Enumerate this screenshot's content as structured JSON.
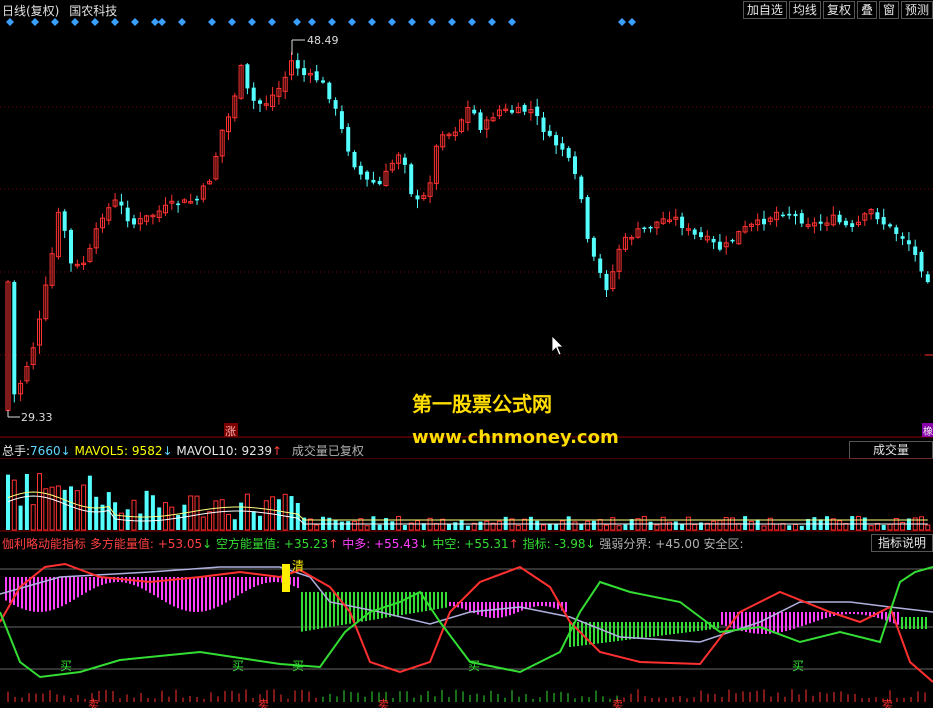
{
  "title": {
    "period": "日线(复权)",
    "stock_name": "国农科技"
  },
  "toolbar": [
    {
      "id": "add-watch",
      "label": "加自选"
    },
    {
      "id": "ma-lines",
      "label": "均线"
    },
    {
      "id": "adjust",
      "label": "复权"
    },
    {
      "id": "overlay",
      "label": "叠"
    },
    {
      "id": "window",
      "label": "窗"
    },
    {
      "id": "forecast",
      "label": "预测"
    }
  ],
  "price_chart": {
    "high_label": "48.49",
    "low_label": "29.33",
    "marker_label": "涨",
    "right_edge_label": "橡",
    "up_color": "#ff3232",
    "down_color": "#54ffff"
  },
  "volume_header": {
    "total_label": "总手:",
    "total_value": "7660",
    "total_arrow": "↓",
    "mavol5_label": "MAVOL5:",
    "mavol5_value": "9582",
    "mavol5_arrow": "↓",
    "mavol10_label": "MAVOL10:",
    "mavol10_value": "9239",
    "mavol10_arrow": "↑",
    "note": "成交量已复权"
  },
  "volume_button": "成交量",
  "indicator_header": {
    "name": "伽利略动能指标",
    "long_label": "多方能量值:",
    "long_value": "+53.05",
    "long_arrow": "↓",
    "short_label": "空方能量值:",
    "short_value": "+35.23",
    "short_arrow": "↑",
    "mid_long_label": "中多:",
    "mid_long_value": "+55.43",
    "mid_long_arrow": "↓",
    "mid_short_label": "中空:",
    "mid_short_value": "+55.31",
    "mid_short_arrow": "↑",
    "index_label": "指标:",
    "index_value": "-3.98",
    "index_arrow": "↓",
    "boundary_label": "强弱分界:",
    "boundary_value": "+45.00",
    "safe_label": "安全区:"
  },
  "indicator_button": "指标说明",
  "indicator_signal": {
    "label": "清"
  },
  "indicator_marks": {
    "buy_label": "买",
    "sell_label": "卖"
  },
  "watermark": {
    "line1": "第一股票公式网",
    "line2": "www.chnmoney.com"
  },
  "colors": {
    "accent_blue": "#3aa0ff",
    "magenta": "#ff40ff",
    "green": "#33dd33",
    "red": "#ff3030"
  }
}
